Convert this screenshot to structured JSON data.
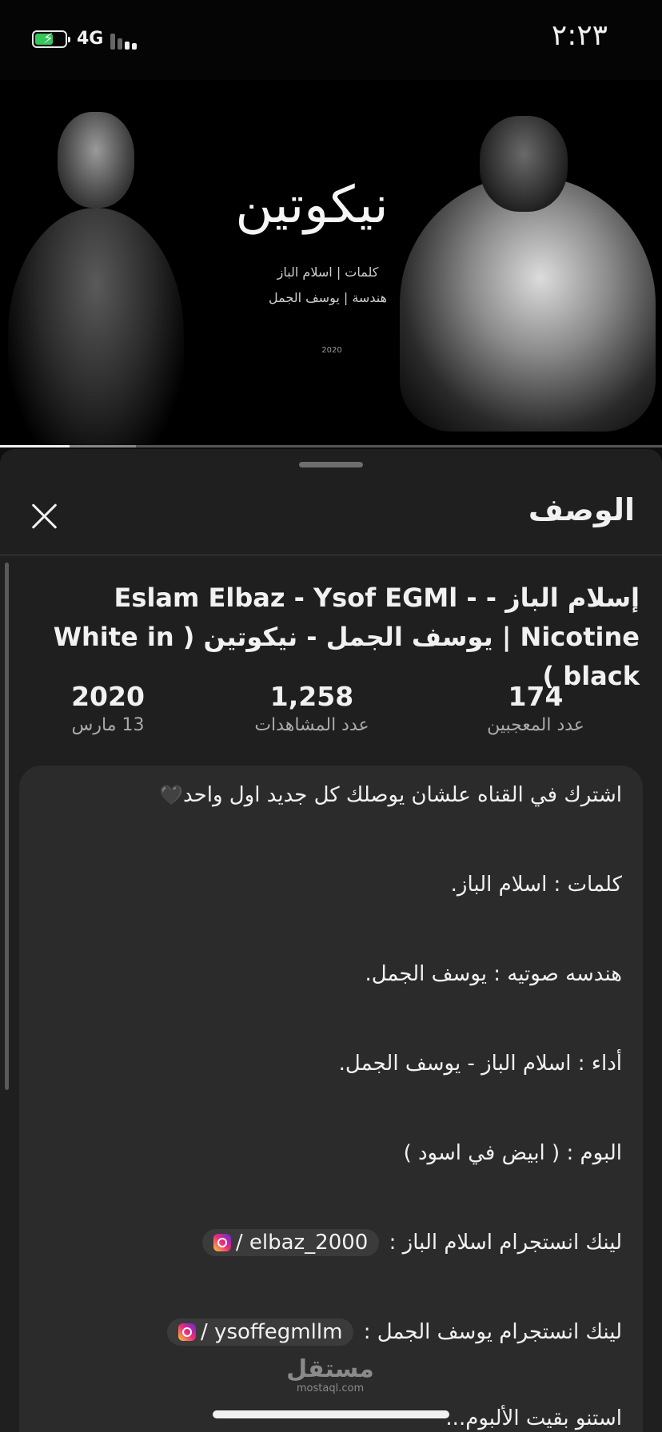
{
  "status_bar": {
    "time": "٢:٢٣",
    "network": "4G",
    "battery_level": 0.6,
    "charging": true
  },
  "video": {
    "thumbnail_title": "نيكوتين",
    "thumbnail_credits": [
      "كلمات  |  اسلام الباز",
      "هندسة  |  يوسف الجمل"
    ],
    "thumbnail_small": [
      "2020"
    ],
    "played_fraction": 0.105,
    "buffered_fraction": 0.205
  },
  "panel": {
    "title": "الوصف",
    "video_title": "إسلام الباز - Eslam Elbaz - Ysof EGMl - Nicotine | يوسف الجمل - نيكوتين ( White in black )",
    "stats": {
      "likes_value": "174",
      "likes_label": "عدد المعجبين",
      "views_value": "1,258",
      "views_label": "عدد المشاهدات",
      "year_value": "2020",
      "date_label": "13 مارس"
    },
    "description": {
      "line1": "اشترك في القناه علشان يوصلك كل جديد اول واحد",
      "line2": "كلمات : اسلام الباز.",
      "line3": "هندسه صوتيه : يوسف الجمل.",
      "line4": "أداء : اسلام الباز - يوسف الجمل.",
      "line5": "البوم : ( ابيض في اسود )",
      "line6_prefix": "لينك انستجرام اسلام الباز :",
      "line6_chip": "/ elbaz_2000",
      "line7_prefix": "لينك انستجرام يوسف الجمل :",
      "line7_chip": "/ ysoffegmllm",
      "line8": "استنو بقيت الألبوم..."
    }
  },
  "watermark": {
    "arabic": "مستقل",
    "latin": "mostaql.com"
  },
  "icons": {
    "close": "close-icon",
    "instagram": "instagram-icon",
    "heart": "black-heart-icon"
  }
}
